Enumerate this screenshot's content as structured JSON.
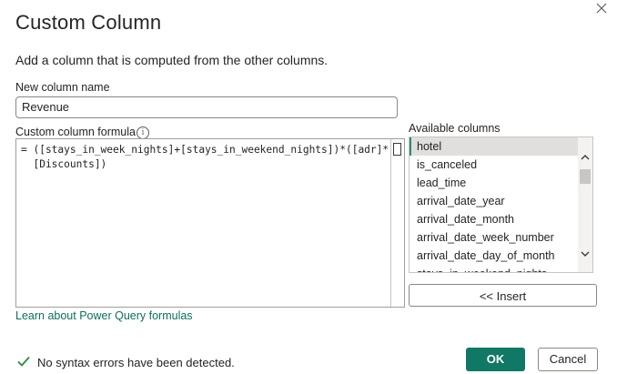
{
  "dialog": {
    "title": "Custom Column",
    "description": "Add a column that is computed from the other columns."
  },
  "new_column": {
    "label": "New column name",
    "value": "Revenue"
  },
  "formula": {
    "label": "Custom column formula",
    "line1": "= ([stays_in_week_nights]+[stays_in_weekend_nights])*([adr]*",
    "line2": "  [Discounts])"
  },
  "available_columns": {
    "label": "Available columns",
    "items": [
      "hotel",
      "is_canceled",
      "lead_time",
      "arrival_date_year",
      "arrival_date_month",
      "arrival_date_week_number",
      "arrival_date_day_of_month",
      "stays_in_weekend_nights"
    ],
    "selected": "hotel"
  },
  "insert_label": "<< Insert",
  "learn_link": "Learn about Power Query formulas",
  "status": "No syntax errors have been detected.",
  "buttons": {
    "ok": "OK",
    "cancel": "Cancel"
  },
  "colors": {
    "accent": "#117865",
    "link": "#0f6e5a",
    "success": "#2a8a3a"
  },
  "icons": {
    "close": "close-icon",
    "info": "info-icon",
    "check": "checkmark-icon"
  }
}
